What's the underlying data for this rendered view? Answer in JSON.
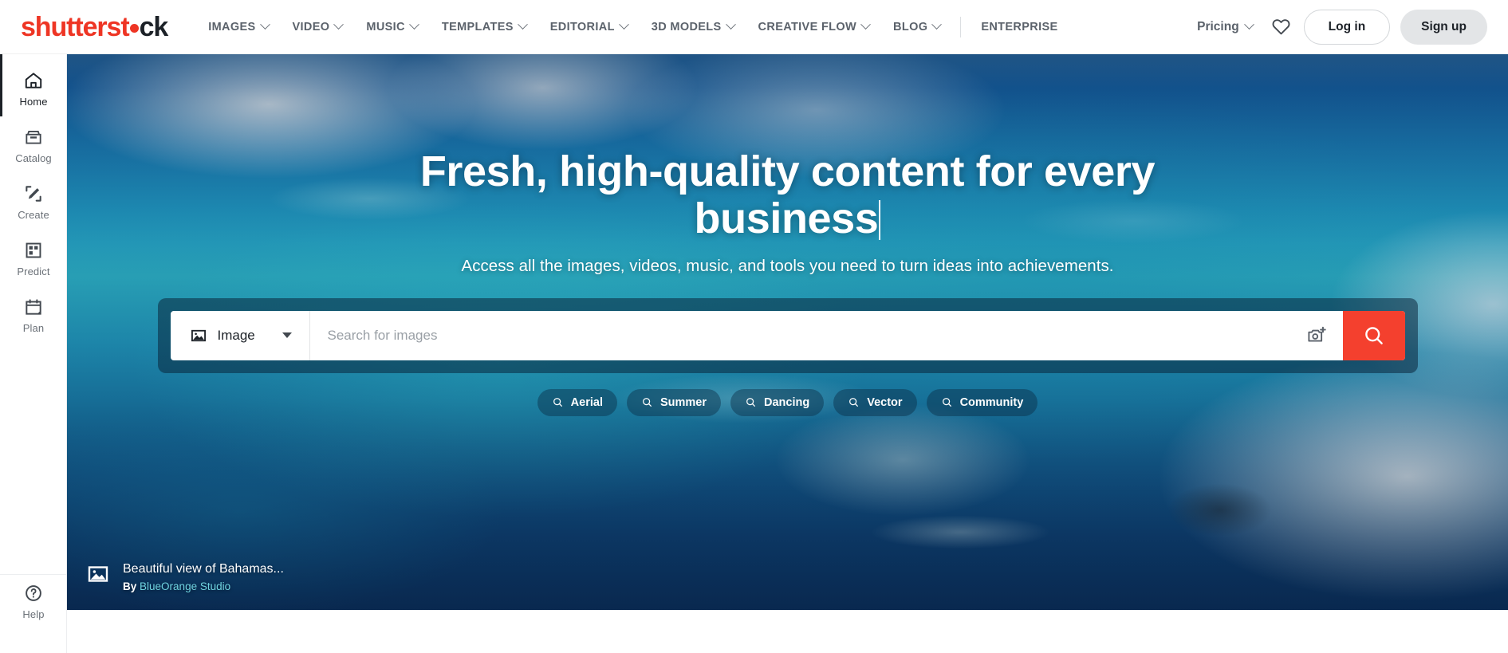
{
  "header": {
    "logo": {
      "part1": "shutterst",
      "dot": "o",
      "part2": "ck"
    },
    "nav": [
      {
        "label": "IMAGES",
        "caret": true
      },
      {
        "label": "VIDEO",
        "caret": true
      },
      {
        "label": "MUSIC",
        "caret": true
      },
      {
        "label": "TEMPLATES",
        "caret": true
      },
      {
        "label": "EDITORIAL",
        "caret": true
      },
      {
        "label": "3D MODELS",
        "caret": true
      },
      {
        "label": "CREATIVE FLOW",
        "caret": true
      },
      {
        "label": "BLOG",
        "caret": true
      },
      {
        "label": "ENTERPRISE",
        "caret": false
      }
    ],
    "pricing_label": "Pricing",
    "favorites_icon": "heart-icon",
    "login_label": "Log in",
    "signup_label": "Sign up"
  },
  "sidebar": {
    "items": [
      {
        "label": "Home",
        "icon": "home-icon",
        "active": true
      },
      {
        "label": "Catalog",
        "icon": "catalog-icon",
        "active": false
      },
      {
        "label": "Create",
        "icon": "create-icon",
        "active": false
      },
      {
        "label": "Predict",
        "icon": "predict-icon",
        "active": false
      },
      {
        "label": "Plan",
        "icon": "plan-icon",
        "active": false
      }
    ],
    "help": {
      "label": "Help",
      "icon": "question-circle-icon"
    }
  },
  "hero": {
    "headline": "Fresh, high-quality content for every business",
    "subheadline": "Access all the images, videos, music, and tools you need to turn ideas into achievements.",
    "search": {
      "type_label": "Image",
      "type_icon": "image-icon",
      "placeholder": "Search for images",
      "value": "",
      "camera_icon": "camera-plus-icon",
      "search_icon": "search-icon",
      "button_color": "#f4402e"
    },
    "chips": [
      {
        "label": "Aerial",
        "icon": "search-icon"
      },
      {
        "label": "Summer",
        "icon": "search-icon"
      },
      {
        "label": "Dancing",
        "icon": "search-icon"
      },
      {
        "label": "Vector",
        "icon": "search-icon"
      },
      {
        "label": "Community",
        "icon": "search-icon"
      }
    ],
    "credit": {
      "icon": "image-icon",
      "title": "Beautiful view of Bahamas...",
      "by_label": "By",
      "author": "BlueOrange Studio"
    }
  },
  "colors": {
    "brand_red": "#ee3524",
    "search_button": "#f4402e",
    "author_link": "#6fd3e0",
    "text_dark": "#1c2127",
    "text_muted": "#5b626b"
  }
}
